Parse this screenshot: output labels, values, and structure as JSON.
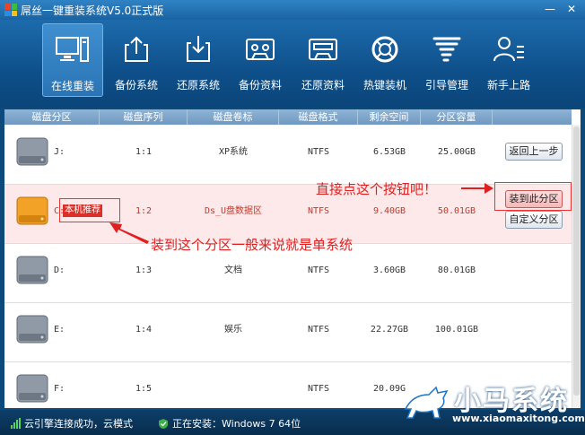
{
  "window": {
    "title": "屌丝一键重装系统V5.0正式版",
    "minimize": "—",
    "close": "✕"
  },
  "toolbar": [
    {
      "label": "在线重装",
      "icon": "monitor-icon",
      "active": true
    },
    {
      "label": "备份系统",
      "icon": "upload-icon"
    },
    {
      "label": "还原系统",
      "icon": "download-icon"
    },
    {
      "label": "备份资料",
      "icon": "tape-icon"
    },
    {
      "label": "还原资料",
      "icon": "tape-restore-icon"
    },
    {
      "label": "热键装机",
      "icon": "lifebuoy-icon"
    },
    {
      "label": "引导管理",
      "icon": "tornado-icon"
    },
    {
      "label": "新手上路",
      "icon": "user-guide-icon"
    }
  ],
  "table": {
    "headers": [
      "磁盘分区",
      "磁盘序列",
      "磁盘卷标",
      "磁盘格式",
      "剩余空间",
      "分区容量"
    ],
    "rows": [
      {
        "letter": "J:",
        "seq": "1:1",
        "label": "XP系统",
        "fs": "NTFS",
        "free": "6.53GB",
        "size": "25.00GB"
      },
      {
        "letter": "C:",
        "seq": "1:2",
        "label": "Ds_U盘数据区",
        "fs": "NTFS",
        "free": "9.40GB",
        "size": "50.01GB"
      },
      {
        "letter": "D:",
        "seq": "1:3",
        "label": "文档",
        "fs": "NTFS",
        "free": "3.60GB",
        "size": "80.01GB"
      },
      {
        "letter": "E:",
        "seq": "1:4",
        "label": "娱乐",
        "fs": "NTFS",
        "free": "22.27GB",
        "size": "100.01GB"
      },
      {
        "letter": "F:",
        "seq": "1:5",
        "label": "",
        "fs": "NTFS",
        "free": "20.09G",
        "size": ""
      }
    ],
    "recommend_tag": "本机推荐"
  },
  "buttons": {
    "back": "返回上一步",
    "install": "装到此分区",
    "custom": "自定义分区"
  },
  "annotations": {
    "click_hint": "直接点这个按钮吧！",
    "partition_hint": "装到这个分区一般来说就是单系统"
  },
  "status": {
    "cloud": "云引擎连接成功，云模式",
    "installing": "正在安装：Windows 7 64位"
  },
  "watermark": {
    "name": "小马系统",
    "url": "www.xiaomaxitong.com"
  },
  "colors": {
    "accent": "#1a63a3",
    "annotation": "#e02020",
    "selected_row": "#fde9e9"
  }
}
